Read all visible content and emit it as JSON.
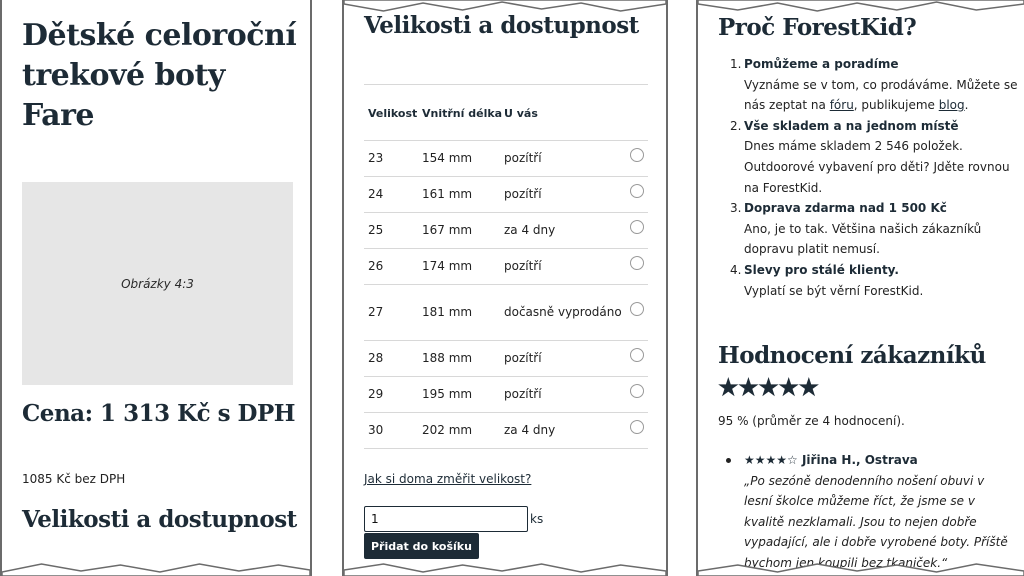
{
  "product": {
    "title": "Dětské celoroční trekové boty Fare",
    "image_placeholder": "Obrázky 4:3",
    "price_label": "Cena: 1 313 Kč s DPH",
    "price_netto": "1085 Kč bez DPH",
    "sizes_heading": "Velikosti a dostupnost"
  },
  "sizes": {
    "heading": "Velikosti a dostupnost",
    "columns": [
      "Velikost",
      "Vnitřní délka",
      "U vás"
    ],
    "rows": [
      {
        "size": "23",
        "length": "154 mm",
        "availability": "pozítří"
      },
      {
        "size": "24",
        "length": "161 mm",
        "availability": "pozítří"
      },
      {
        "size": "25",
        "length": "167 mm",
        "availability": "za 4 dny"
      },
      {
        "size": "26",
        "length": "174 mm",
        "availability": "pozítří"
      },
      {
        "size": "27",
        "length": "181 mm",
        "availability": "dočasně vyprodáno"
      },
      {
        "size": "28",
        "length": "188 mm",
        "availability": "pozítří"
      },
      {
        "size": "29",
        "length": "195 mm",
        "availability": "pozítří"
      },
      {
        "size": "30",
        "length": "202 mm",
        "availability": "za 4 dny"
      }
    ],
    "measure_link": "Jak si doma změřit velikost?",
    "quantity_value": "1",
    "quantity_unit": "ks",
    "add_to_cart": "Přidat do košíku"
  },
  "why": {
    "heading": "Proč ForestKid?",
    "items": [
      {
        "num": "1.",
        "title": "Pomůžeme a poradíme",
        "text_a": "Vyznáme se v tom, co prodáváme. Můžete se nás zeptat na ",
        "link1": "fóru",
        "text_b": ", publikujeme ",
        "link2": "blog",
        "text_c": "."
      },
      {
        "num": "2.",
        "title": "Vše skladem a na jednom místě",
        "text": "Dnes máme skladem 2 546 položek. Outdoorové vybavení pro děti? Jděte rovnou na ForestKid."
      },
      {
        "num": "3.",
        "title": "Doprava zdarma nad 1 500 Kč",
        "text": "Ano, je to tak. Většina našich zákazníků dopravu platit nemusí."
      },
      {
        "num": "4.",
        "title": "Slevy pro stálé klienty.",
        "text": "Vyplatí se být věrní ForestKid."
      }
    ]
  },
  "reviews": {
    "heading": "Hodnocení zákazníků ★★★★★",
    "average": "95 % (průměr ze 4 hodnocení).",
    "items": [
      {
        "header": "★★★★☆ Jiřina H., Ostrava",
        "quote": "„Po sezóně denodenního nošení obuvi v lesní školce můžeme říct, že jsme se v kvalitě nezklamali. Jsou to nejen dobře vypadající, ale i dobře vyrobené boty. Příště bychom jen koupili bez tkaniček.“"
      }
    ]
  }
}
